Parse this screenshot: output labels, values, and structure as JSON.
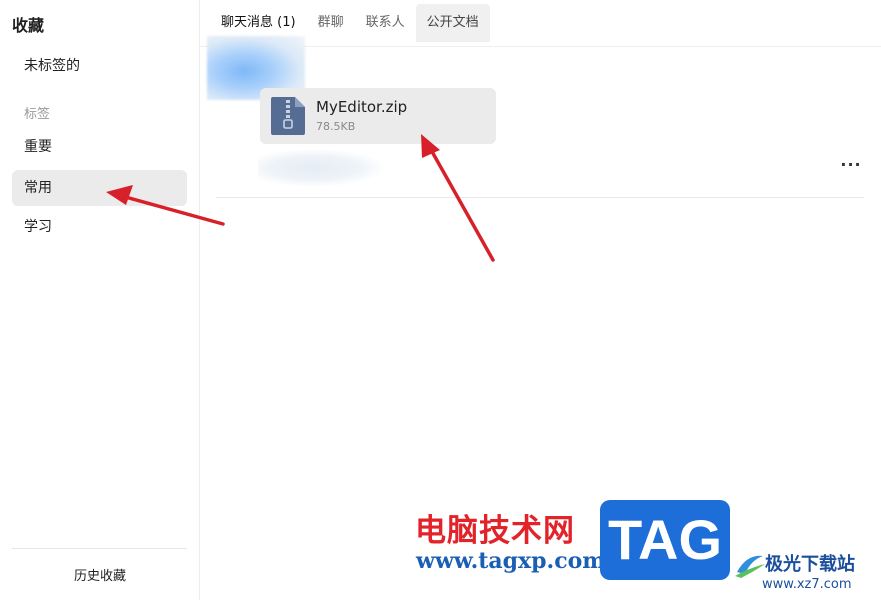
{
  "sidebar": {
    "title": "收藏",
    "items": [
      {
        "label": "未标签的"
      },
      {
        "label": "重要"
      },
      {
        "label": "常用"
      },
      {
        "label": "学习"
      }
    ],
    "section_label": "标签",
    "history_label": "历史收藏",
    "active_item": "常用"
  },
  "tabs": [
    {
      "label": "聊天消息 (1)"
    },
    {
      "label": "群聊"
    },
    {
      "label": "联系人"
    },
    {
      "label": "公开文档"
    }
  ],
  "file": {
    "name": "MyEditor.zip",
    "size": "78.5KB",
    "icon": "zip-file-icon"
  },
  "more_label": "···",
  "watermark": {
    "site_name": "电脑技术网",
    "url": "www.tagxp.com",
    "tag": "TAG",
    "partner_name": "极光下载站",
    "partner_url": "www.xz7.com"
  },
  "colors": {
    "arrow": "#d8202a",
    "active_item_bg": "#ebebeb",
    "file_icon": "#566d93",
    "watermark_red": "#e3232a",
    "watermark_blue": "#1d6ed8"
  }
}
